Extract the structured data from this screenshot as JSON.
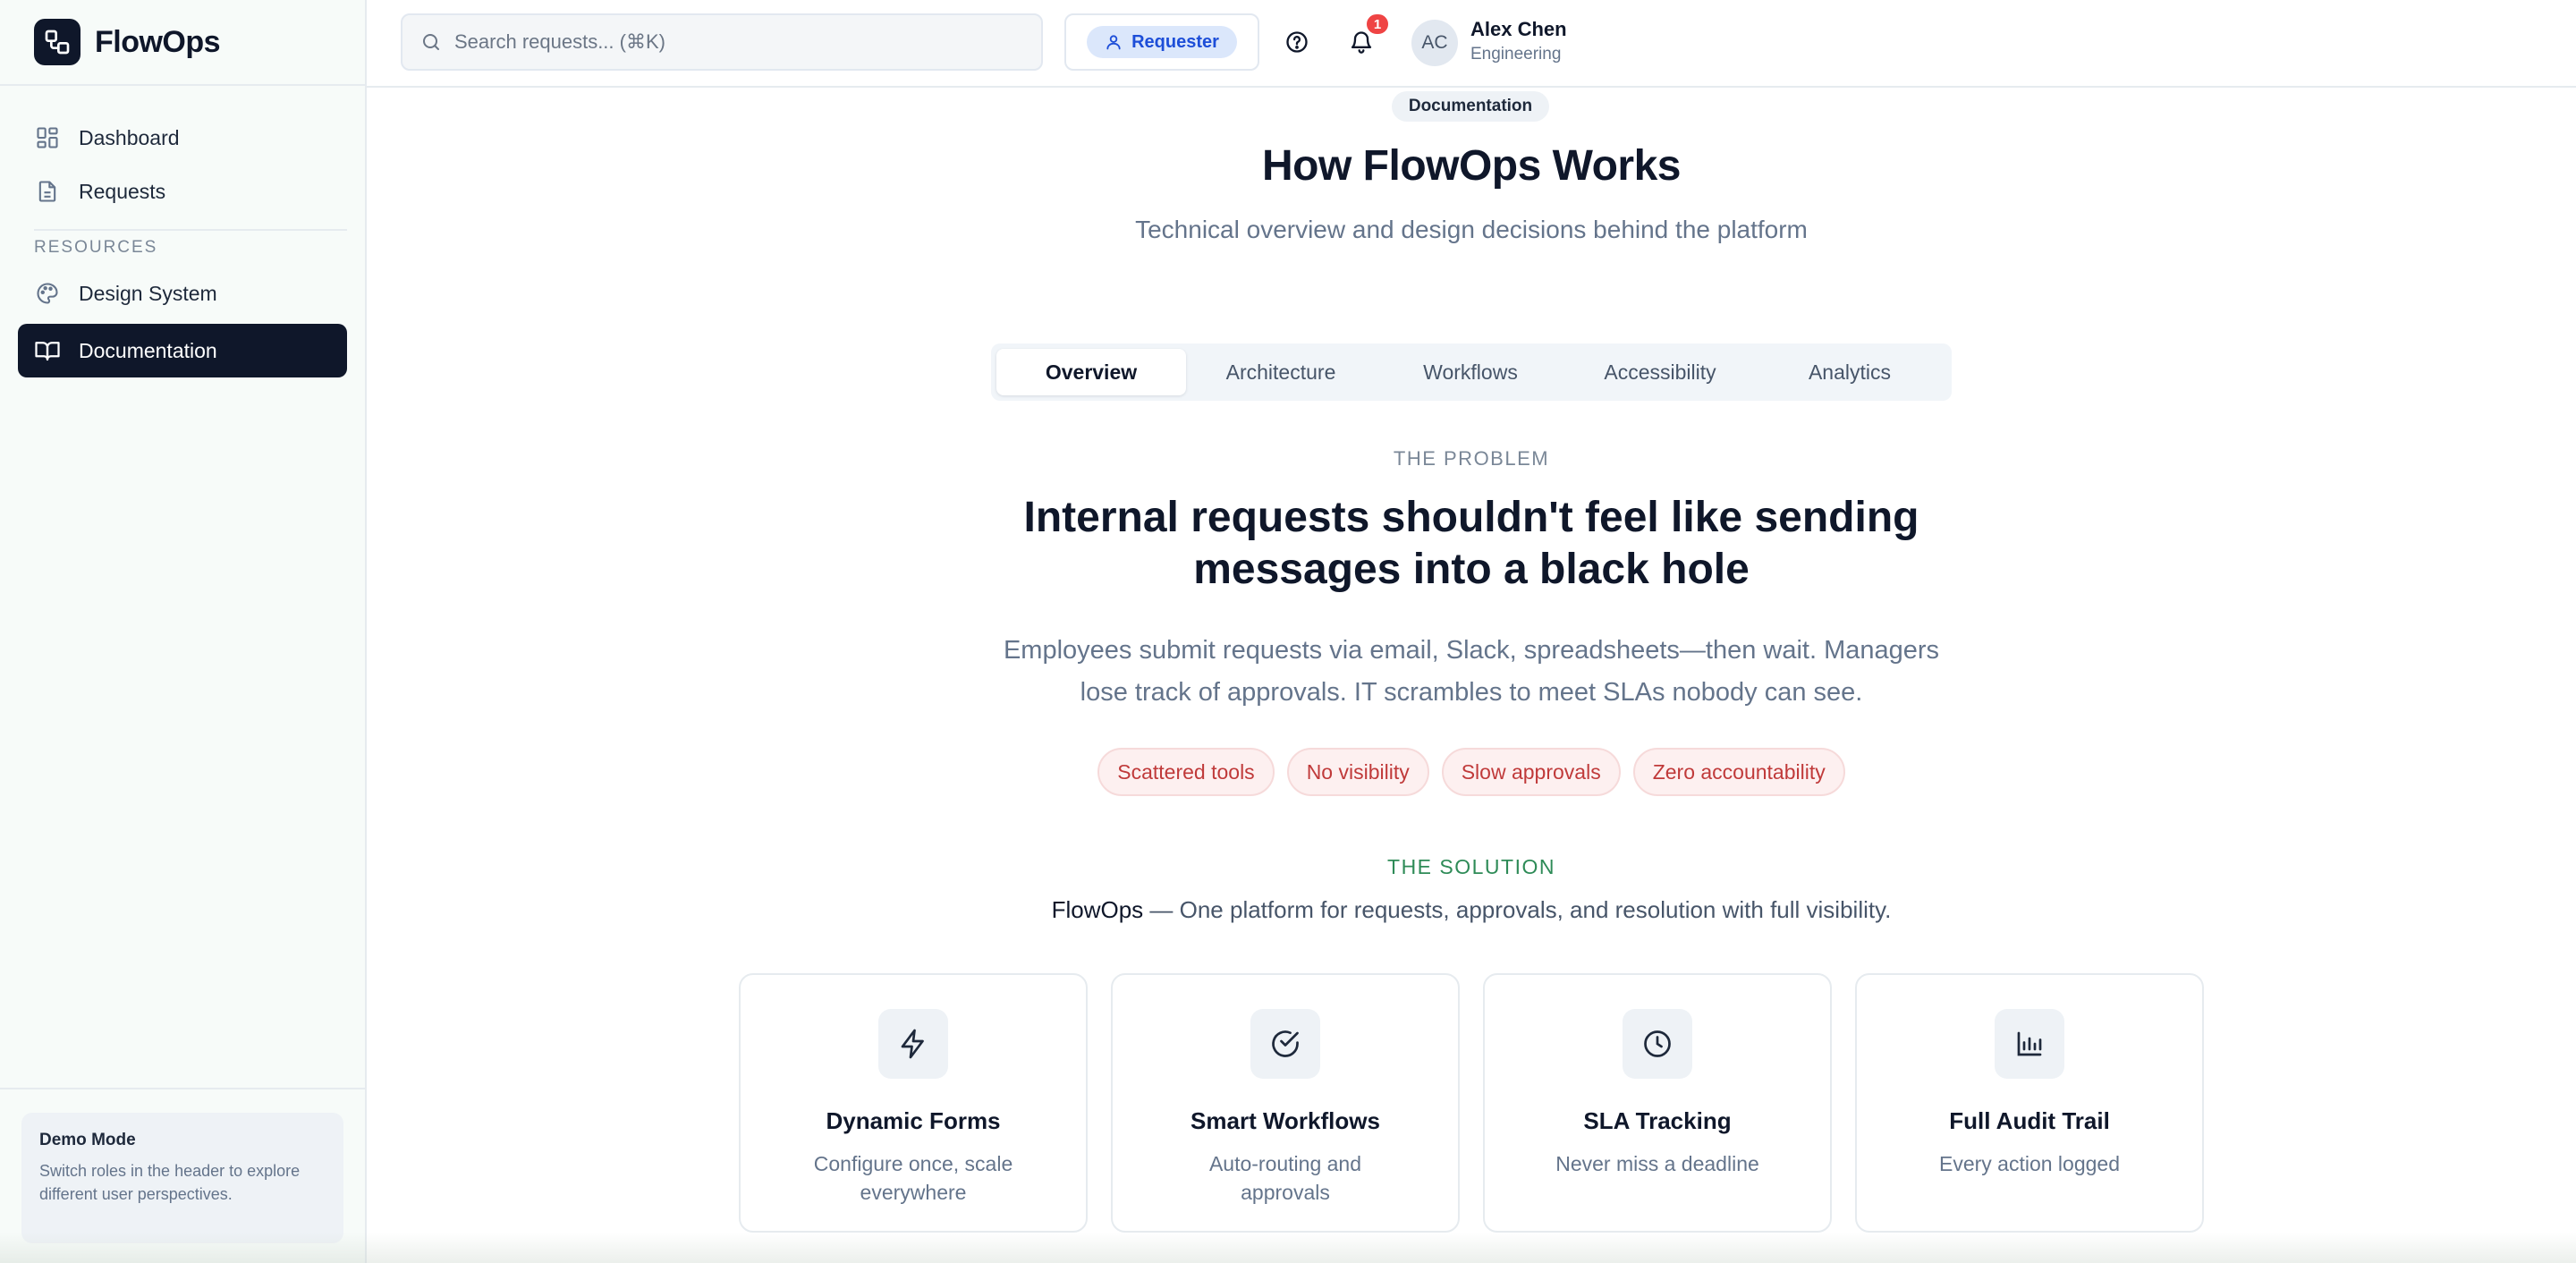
{
  "app": {
    "name": "FlowOps"
  },
  "sidebar": {
    "items": [
      {
        "label": "Dashboard",
        "icon": "dashboard-grid-icon"
      },
      {
        "label": "Requests",
        "icon": "document-icon"
      }
    ],
    "section_label": "RESOURCES",
    "resources": [
      {
        "label": "Design System",
        "icon": "palette-icon"
      },
      {
        "label": "Documentation",
        "icon": "book-open-icon",
        "active": true
      }
    ],
    "demo": {
      "title": "Demo Mode",
      "text": "Switch roles in the header to explore different user perspectives."
    }
  },
  "header": {
    "search_placeholder": "Search requests... (⌘K)",
    "role_label": "Requester",
    "notification_count": "1",
    "user": {
      "initials": "AC",
      "name": "Alex Chen",
      "department": "Engineering"
    }
  },
  "main": {
    "doc_tag": "Documentation",
    "title": "How FlowOps Works",
    "subtitle": "Technical overview and design decisions behind the platform",
    "tabs": [
      {
        "label": "Overview",
        "active": true
      },
      {
        "label": "Architecture"
      },
      {
        "label": "Workflows"
      },
      {
        "label": "Accessibility"
      },
      {
        "label": "Analytics"
      }
    ],
    "problem": {
      "label": "THE PROBLEM",
      "title_line1": "Internal requests shouldn't feel like sending",
      "title_line2": "messages into a black hole",
      "desc_line1": "Employees submit requests via email, Slack, spreadsheets—then wait. Managers",
      "desc_line2": "lose track of approvals. IT scrambles to meet SLAs nobody can see.",
      "tags": [
        "Scattered tools",
        "No visibility",
        "Slow approvals",
        "Zero accountability"
      ]
    },
    "solution": {
      "label": "THE SOLUTION",
      "brand": "FlowOps",
      "text": " — One platform for requests, approvals, and resolution with full visibility."
    },
    "cards": [
      {
        "title": "Dynamic Forms",
        "desc": "Configure once, scale everywhere",
        "icon": "lightning-icon"
      },
      {
        "title": "Smart Workflows",
        "desc": "Auto-routing and approvals",
        "icon": "check-circle-icon"
      },
      {
        "title": "SLA Tracking",
        "desc": "Never miss a deadline",
        "icon": "clock-icon"
      },
      {
        "title": "Full Audit Trail",
        "desc": "Every action logged",
        "icon": "bar-chart-icon"
      }
    ]
  },
  "colors": {
    "primary": "#0f172a",
    "accent_blue": "#1d4ed8",
    "danger": "#c03a3a",
    "success": "#2e8b57",
    "badge": "#ef4444"
  }
}
